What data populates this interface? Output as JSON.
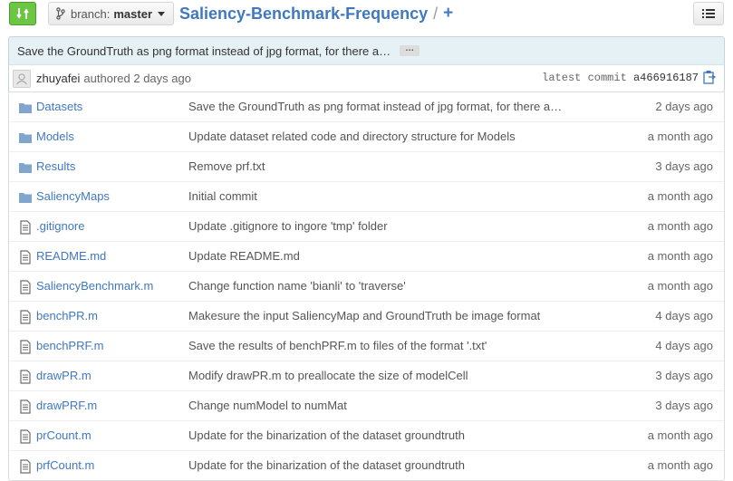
{
  "header": {
    "branch_label": "branch:",
    "branch_name": "master",
    "repo_name": "Saliency-Benchmark-Frequency",
    "separator": "/",
    "add_symbol": "+"
  },
  "latest_commit": {
    "message": "Save the GroundTruth as png format instead of jpg format, for there a…",
    "ellipsis": "…",
    "author": "zhuyafei",
    "authored_text": "authored 2 days ago",
    "latest_label": "latest commit",
    "sha": "a466916187"
  },
  "files": [
    {
      "type": "folder",
      "name": "Datasets",
      "message": "Save the GroundTruth as png format instead of jpg format, for there a…",
      "age": "2 days ago"
    },
    {
      "type": "folder",
      "name": "Models",
      "message": "Update dataset related code and directory structure for Models",
      "age": "a month ago"
    },
    {
      "type": "folder",
      "name": "Results",
      "message": "Remove prf.txt",
      "age": "3 days ago"
    },
    {
      "type": "folder",
      "name": "SaliencyMaps",
      "message": "Initial commit",
      "age": "a month ago"
    },
    {
      "type": "file",
      "name": ".gitignore",
      "message": "Update .gitignore to ingore 'tmp' folder",
      "age": "a month ago"
    },
    {
      "type": "file",
      "name": "README.md",
      "message": "Update README.md",
      "age": "a month ago"
    },
    {
      "type": "file",
      "name": "SaliencyBenchmark.m",
      "message": "Change function name 'bianli' to 'traverse'",
      "age": "a month ago"
    },
    {
      "type": "file",
      "name": "benchPR.m",
      "message": "Makesure the input SaliencyMap and GroundTruth be image format",
      "age": "4 days ago"
    },
    {
      "type": "file",
      "name": "benchPRF.m",
      "message": "Save the results of benchPRF.m to files of the format '.txt'",
      "age": "4 days ago"
    },
    {
      "type": "file",
      "name": "drawPR.m",
      "message": "Modify drawPR.m to preallocate the size of modelCell",
      "age": "3 days ago"
    },
    {
      "type": "file",
      "name": "drawPRF.m",
      "message": "Change numModel to numMat",
      "age": "3 days ago"
    },
    {
      "type": "file",
      "name": "prCount.m",
      "message": "Update for the binarization of the dataset groundtruth",
      "age": "a month ago"
    },
    {
      "type": "file",
      "name": "prfCount.m",
      "message": "Update for the binarization of the dataset groundtruth",
      "age": "a month ago"
    }
  ],
  "colors": {
    "accent": "#4078c0",
    "compare_button": "#6cc644",
    "folder_icon": "#80a6cd",
    "file_icon": "#6d6d6d"
  },
  "icons": {
    "compare": "compare-icon",
    "branch": "branch-icon",
    "list": "list-icon",
    "clipboard": "clipboard-icon",
    "folder": "folder-icon",
    "file": "file-icon"
  }
}
